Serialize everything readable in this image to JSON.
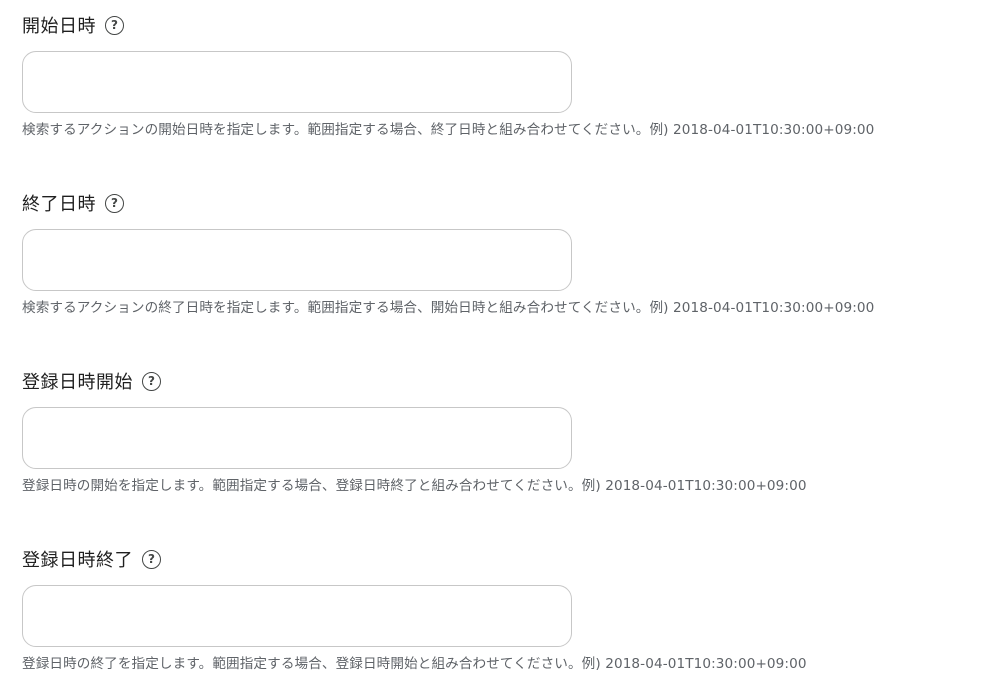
{
  "fields": [
    {
      "label": "開始日時",
      "help_icon": "question-circle-icon",
      "help_glyph": "?",
      "value": "",
      "placeholder": "",
      "hint": "検索するアクションの開始日時を指定します。範囲指定する場合、終了日時と組み合わせてください。例) 2018-04-01T10:30:00+09:00"
    },
    {
      "label": "終了日時",
      "help_icon": "question-circle-icon",
      "help_glyph": "?",
      "value": "",
      "placeholder": "",
      "hint": "検索するアクションの終了日時を指定します。範囲指定する場合、開始日時と組み合わせてください。例) 2018-04-01T10:30:00+09:00"
    },
    {
      "label": "登録日時開始",
      "help_icon": "question-circle-icon",
      "help_glyph": "?",
      "value": "",
      "placeholder": "",
      "hint": "登録日時の開始を指定します。範囲指定する場合、登録日時終了と組み合わせてください。例) 2018-04-01T10:30:00+09:00"
    },
    {
      "label": "登録日時終了",
      "help_icon": "question-circle-icon",
      "help_glyph": "?",
      "value": "",
      "placeholder": "",
      "hint": "登録日時の終了を指定します。範囲指定する場合、登録日時開始と組み合わせてください。例) 2018-04-01T10:30:00+09:00"
    }
  ],
  "colors": {
    "label": "#1f1f1f",
    "hint": "#5f6368",
    "input_border": "#c7c7c7",
    "icon": "#444746"
  }
}
